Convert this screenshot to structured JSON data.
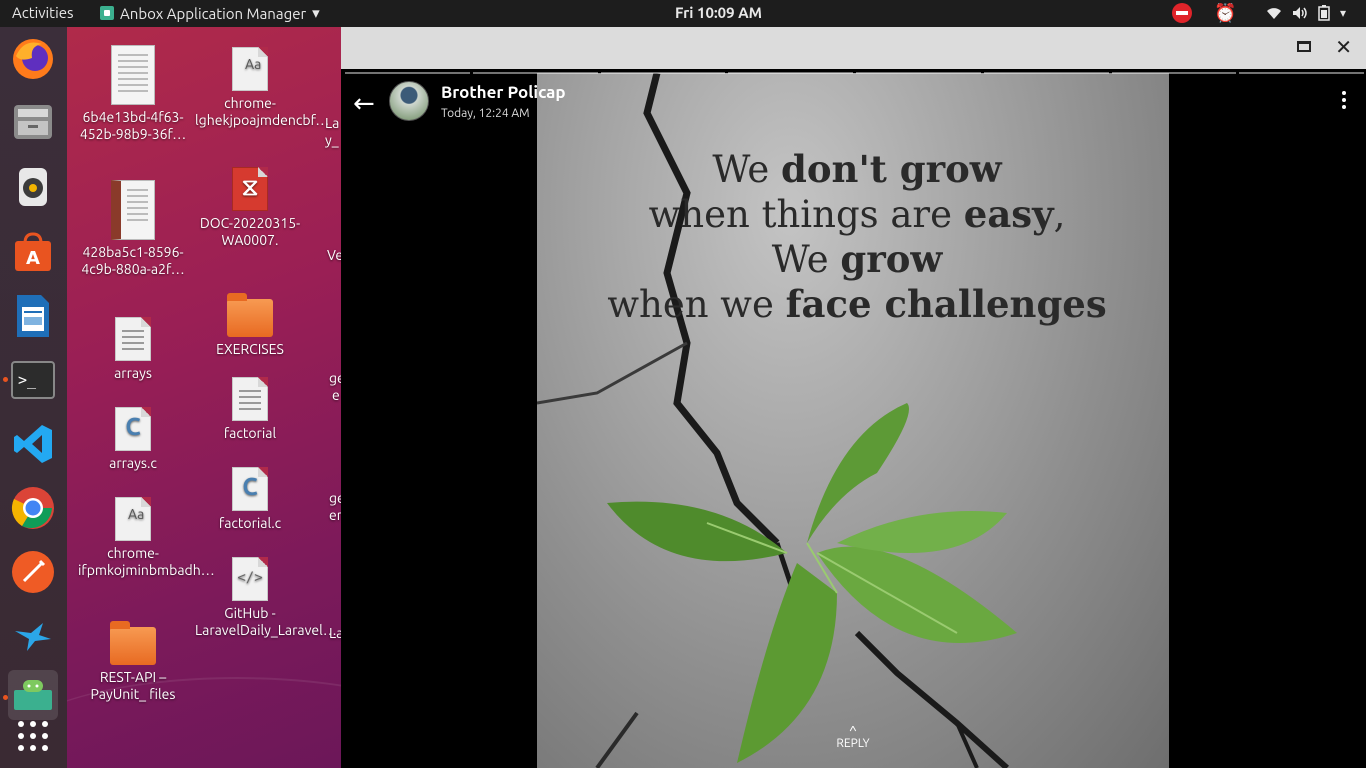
{
  "topbar": {
    "activities": "Activities",
    "app_name": "Anbox Application Manager",
    "app_menu_arrow": "▾",
    "clock": "Fri 10:09 AM",
    "tray_icons": [
      "do-not-disturb-icon",
      "alarm-icon",
      "wifi-icon",
      "volume-icon",
      "battery-icon",
      "chevron-down-icon"
    ]
  },
  "dock": {
    "items": [
      "firefox",
      "files",
      "rhythmbox",
      "ubuntu-software",
      "libreoffice-writer",
      "terminal",
      "vscode",
      "chrome",
      "postman",
      "kingfisher",
      "anbox",
      "show-applications"
    ]
  },
  "desktop": {
    "icons": [
      {
        "label": "6b4e13bd-4f63-452b-98b9-36f…"
      },
      {
        "label": "428ba5c1-8596-4c9b-880a-a2f…"
      },
      {
        "label": "arrays"
      },
      {
        "label": "arrays.c"
      },
      {
        "label": "chrome-ifpmkojminbmbadh…"
      },
      {
        "label": "REST-API – PayUnit_ files"
      },
      {
        "label": "chrome-lghekjpoajmdencbf…"
      },
      {
        "label": "DOC-20220315-WA0007."
      },
      {
        "label": "EXERCISES"
      },
      {
        "label": "factorial"
      },
      {
        "label": "factorial.c"
      },
      {
        "label": "GitHub - LaravelDaily_Laravel…"
      }
    ],
    "partial_labels": [
      "La",
      "y_",
      "Ve",
      "ge",
      "e",
      "ge",
      "er",
      "La"
    ]
  },
  "window": {
    "maximize_label": "",
    "close_label": "✕"
  },
  "status": {
    "back_arrow": "←",
    "contact_name": "Brother Policap",
    "timestamp": "Today, 12:24 AM",
    "quote_line1_a": "We ",
    "quote_line1_b": "don't grow",
    "quote_line2_a": "when things are ",
    "quote_line2_b": "easy",
    "quote_line2_c": ",",
    "quote_line3_a": "We ",
    "quote_line3_b": "grow",
    "quote_line4_a": "when we ",
    "quote_line4_b": "face challenges",
    "reply_caret": "^",
    "reply_label": "REPLY"
  }
}
